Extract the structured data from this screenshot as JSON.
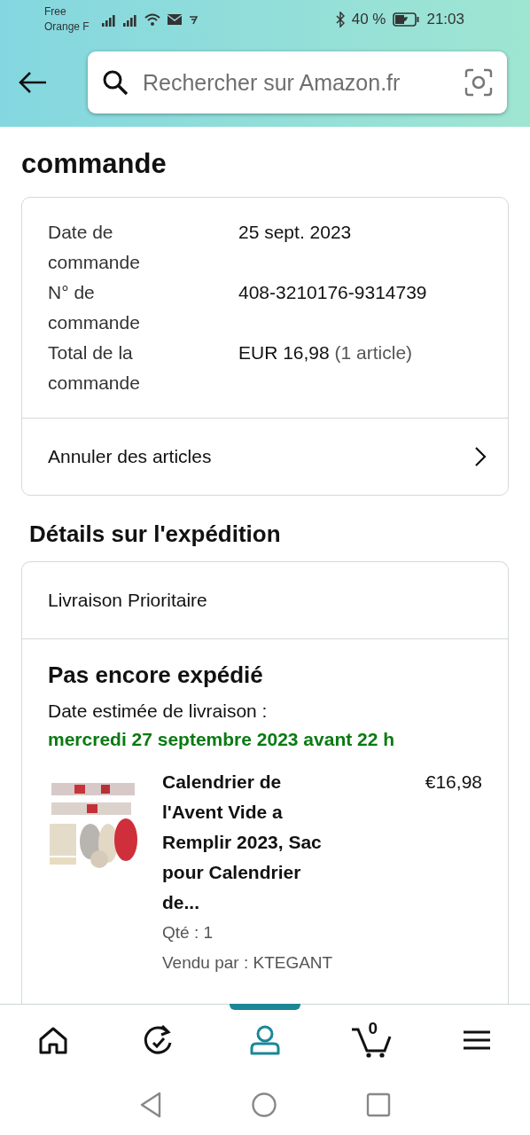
{
  "status_bar": {
    "carrier_lines": [
      "Free",
      "Orange F"
    ],
    "battery": "40 %",
    "time": "21:03"
  },
  "search": {
    "placeholder": "Rechercher sur Amazon.fr"
  },
  "heading": "commande",
  "order_summary": {
    "rows": [
      {
        "label": "Date de commande",
        "value": "25 sept. 2023"
      },
      {
        "label": "N° de commande",
        "value": "408-3210176-9314739"
      },
      {
        "label": "Total de la commande",
        "value": "EUR 16,98",
        "note": "(1 article)"
      }
    ],
    "action": "Annuler des articles"
  },
  "shipment": {
    "title": "Détails sur l'expédition",
    "method": "Livraison Prioritaire",
    "status": "Pas encore expédié",
    "estimate_label": "Date estimée de livraison :",
    "estimate": "mercredi 27 septembre 2023 avant 22 h",
    "items": [
      {
        "title": "Calendrier de l'Avent Vide a Remplir 2023, Sac pour Calendrier de...",
        "price": "€16,98",
        "quantity": "Qté : 1",
        "seller": "Vendu par : KTEGANT"
      }
    ]
  },
  "bottom_nav": [
    {
      "kind": "home",
      "selected": false
    },
    {
      "kind": "orders",
      "selected": false
    },
    {
      "kind": "account",
      "selected": true
    },
    {
      "kind": "cart",
      "count": "0",
      "selected": false
    },
    {
      "kind": "menu",
      "selected": false
    }
  ]
}
